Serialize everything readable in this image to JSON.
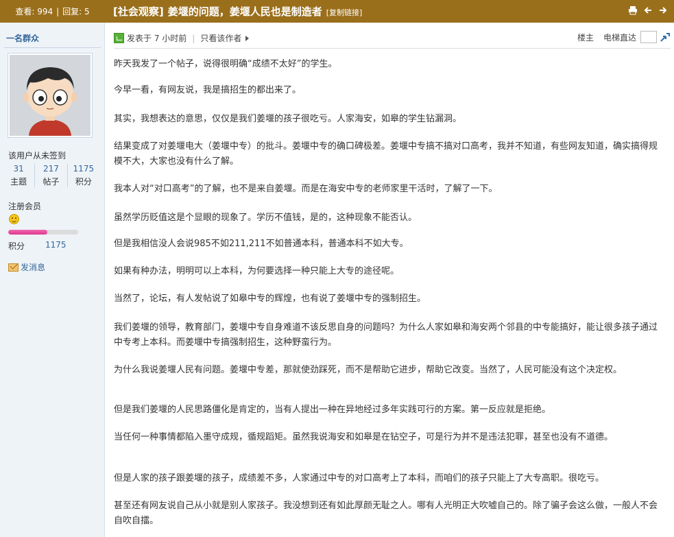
{
  "header": {
    "views_label": "查看:",
    "views": "994",
    "replies_label": "回复:",
    "replies": "5",
    "category": "[社会观察]",
    "subject": "姜堰的问题，姜堰人民也是制造者",
    "copy_link": "[复制链接]",
    "background": "#9a6f1c"
  },
  "user": {
    "name": "一名群众",
    "checkin_status": "该用户从未签到",
    "topics": "31",
    "topics_label": "主题",
    "posts": "217",
    "posts_label": "帖子",
    "credits": "1175",
    "credits_label": "积分",
    "rank": "注册会员",
    "rank_progress": 0.56,
    "points_label": "积分",
    "points": "1175",
    "send_message": "发消息"
  },
  "post": {
    "posted_time": "发表于 7 小时前",
    "only_author": "只看该作者",
    "floor_label": "楼主",
    "jump_label": "电梯直达",
    "paragraphs": [
      "昨天我发了一个帖子，说得很明确“成绩不太好”的学生。",
      "今早一看，有网友说，我是搞招生的都出来了。",
      "其实，我想表达的意思，仅仅是我们姜堰的孩子很吃亏。人家海安，如皋的学生钻漏洞。",
      "结果变成了对姜堰电大（姜堰中专）的批斗。姜堰中专的确口碑极差。姜堰中专搞不搞对口高考，我并不知道，有些网友知道，确实搞得规模不大，大家也没有什么了解。",
      "我本人对“对口高考”的了解，也不是来自姜堰。而是在海安中专的老师家里干活时，了解了一下。",
      "虽然学历贬值这是个显眼的现象了。学历不值钱，是的，这种现象不能否认。",
      "但是我相信没人会说985不如211,211不如普通本科，普通本科不如大专。",
      "如果有种办法，明明可以上本科，为何要选择一种只能上大专的途径呢。",
      "当然了，论坛，有人发帖说了如皋中专的辉煌，也有说了姜堰中专的强制招生。",
      "我们姜堰的领导，教育部门，姜堰中专自身难道不该反思自身的问题吗？为什么人家如皋和海安两个邻县的中专能搞好，能让很多孩子通过中专考上本科。而姜堰中专搞强制招生，这种野蛮行为。",
      "为什么我说姜堰人民有问题。姜堰中专差，那就使劲踩死，而不是帮助它进步，帮助它改变。当然了，人民可能没有这个决定权。",
      "但是我们姜堰的人民思路僵化是肯定的，当有人提出一种在异地经过多年实践可行的方案。第一反应就是拒绝。",
      "当任何一种事情都陷入墨守成规，循规蹈矩。虽然我说海安和如皋是在钻空子，可是行为并不是违法犯罪，甚至也没有不道德。",
      "但是人家的孩子跟姜堰的孩子，成绩差不多，人家通过中专的对口高考上了本科，而咱们的孩子只能上了大专高职。很吃亏。",
      "甚至还有网友说自己从小就是别人家孩子。我没想到还有如此厚颜无耻之人。哪有人光明正大吹嘘自己的。除了骗子会这么做，一般人不会自吹自擂。"
    ]
  }
}
